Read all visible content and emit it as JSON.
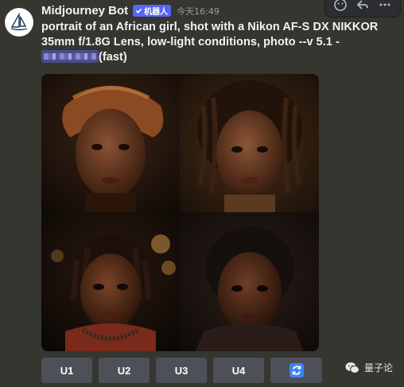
{
  "message": {
    "author": "Midjourney Bot",
    "bot_tag": "机器人",
    "timestamp": "今天16:49",
    "prompt": "portrait of an African girl, shot with a Nikon AF-S DX NIKKOR 35mm f/1.8G Lens, low-light conditions, photo --v 5.1 -",
    "prompt_suffix": "(fast)"
  },
  "image_grid": {
    "alts": [
      "girl with headwrap",
      "girl with braided hair",
      "girl with locs and beaded necklace",
      "girl with short dark hair"
    ]
  },
  "buttons": {
    "u1": "U1",
    "u2": "U2",
    "u3": "U3",
    "u4": "U4",
    "refresh_icon": "refresh-icon"
  },
  "watermark": {
    "label": "量子论",
    "icon": "wechat-icon"
  },
  "colors": {
    "background": "#353630",
    "button": "#4e5058",
    "bot_tag": "#5865f2",
    "refresh_accent": "#3b82f6"
  }
}
